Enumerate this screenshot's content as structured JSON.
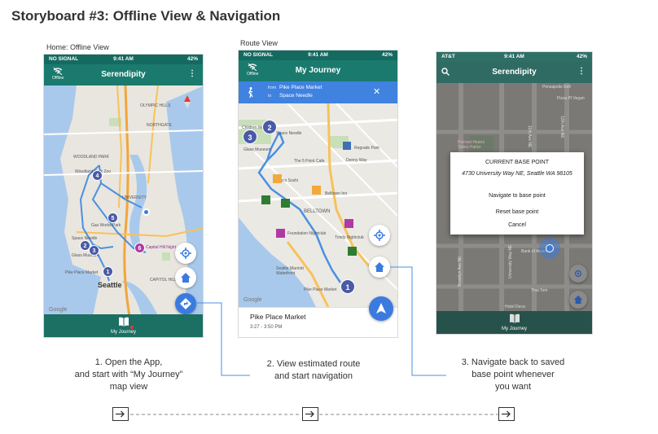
{
  "page": {
    "title": "Storyboard #3: Offline View & Navigation"
  },
  "screens": {
    "home": {
      "label": "Home: Offline View",
      "status": {
        "left": "NO SIGNAL",
        "time": "9:41 AM",
        "battery": "42%"
      },
      "app_title": "Serendipity",
      "offline_label": "Offline",
      "map_labels": [
        "OLYMPIC HILLS",
        "NORTHGATE",
        "WOODLAND PARK",
        "UNIVERSITY",
        "CAPITOL HILL",
        "Seattle",
        "Space Needle",
        "Glass Museum",
        "Gas Works Park",
        "Capital Hill Night",
        "Pike Place Market",
        "Woodland Park Zoo",
        "Google"
      ],
      "markers": [
        "4",
        "5",
        "2",
        "3",
        "1",
        "6"
      ],
      "bottom_label": "My Journey"
    },
    "route": {
      "label": "Route View",
      "status": {
        "left": "NO SIGNAL",
        "time": "9:41 AM",
        "battery": "42%"
      },
      "app_title": "My Journey",
      "offline_label": "Offline",
      "from_label": "from",
      "from_value": "Pike Place Market",
      "to_label": "to",
      "to_value": "Space Needle",
      "map_labels": [
        "Children Museum",
        "Space Needle",
        "Glass Museum",
        "Regrade Park",
        "Denny Way",
        "The 5 Point Cafe",
        "Shiro's Sushi",
        "Belltown Inn",
        "BELLTOWN",
        "Foundation Nightclub",
        "Trinity Nightclub",
        "Seattle Marriott Waterfront",
        "Pike Place Market",
        "Google"
      ],
      "markers": [
        "2",
        "3",
        "1"
      ],
      "card_title": "Pike Place Market",
      "card_time": "3:27 - 3:50 PM"
    },
    "base": {
      "status": {
        "left": "AT&T",
        "time": "9:41 AM",
        "battery": "42%"
      },
      "app_title": "Serendipity",
      "map_labels": [
        "Pensapolis Grill",
        "Pizza Pl Vegan",
        "Pierced Hearts Tattoo Parlor",
        "Bank of America",
        "Thai Tom",
        "Hotel Deca",
        "University Way NE",
        "Brooklyn Ave NE",
        "11th Ave NE",
        "12th Ave NE"
      ],
      "dialog": {
        "title": "CURRENT BASE POINT",
        "address": "4730 University Way NE, Seattle WA 98105",
        "actions": [
          "Navigate to base point",
          "Reset base point",
          "Cancel"
        ]
      },
      "bottom_label": "My Journey"
    }
  },
  "captions": [
    "1. Open the App,\nand start with “My Journey”\nmap view",
    "2. View estimated route\nand start navigation",
    "3. Navigate back to saved\nbase point whenever\nyou want"
  ],
  "colors": {
    "appbar": "#1b7a6e",
    "statusbar": "#156a60",
    "fab_blue": "#3b7be0",
    "route": "#4a90e2",
    "connector": "#4a90e2"
  }
}
